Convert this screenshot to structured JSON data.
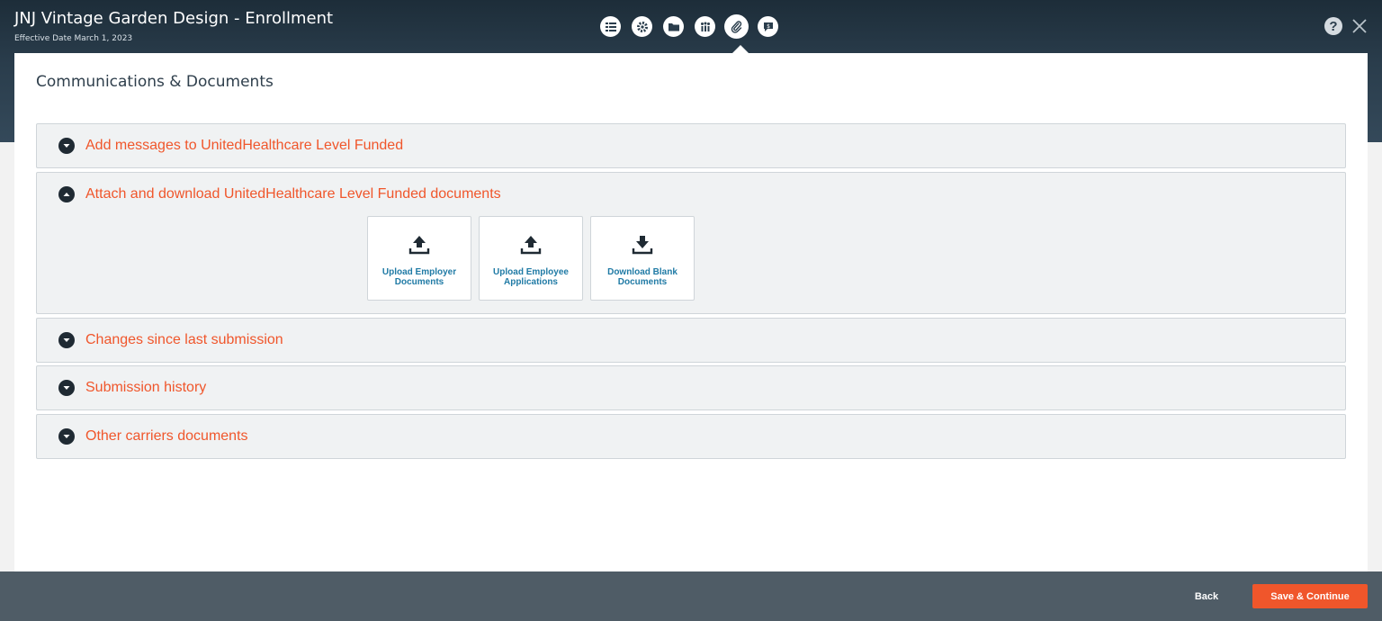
{
  "header": {
    "title": "JNJ Vintage Garden Design - Enrollment",
    "subtitle": "Effective Date March 1, 2023",
    "nav_icons": [
      "checklist-icon",
      "gear-icon",
      "folder-icon",
      "people-icon",
      "paperclip-icon",
      "message-dollar-icon"
    ],
    "active_nav": "paperclip-icon",
    "help_label": "?"
  },
  "page": {
    "title": "Communications & Documents"
  },
  "sections": [
    {
      "label": "Add messages to UnitedHealthcare Level Funded",
      "expanded": false
    },
    {
      "label": "Attach and download UnitedHealthcare Level Funded documents",
      "expanded": true
    },
    {
      "label": "Changes since last submission",
      "expanded": false
    },
    {
      "label": "Submission history",
      "expanded": false
    },
    {
      "label": "Other carriers documents",
      "expanded": false
    }
  ],
  "tiles": [
    {
      "line1": "Upload Employer",
      "line2": "Documents",
      "icon": "upload-icon"
    },
    {
      "line1": "Upload Employee",
      "line2": "Applications",
      "icon": "upload-icon"
    },
    {
      "line1": "Download Blank",
      "line2": "Documents",
      "icon": "download-icon"
    }
  ],
  "footer": {
    "back_label": "Back",
    "save_label": "Save & Continue"
  },
  "colors": {
    "accent": "#f0562b",
    "header_bg": "#2a3d4c",
    "footer_bg": "#4f5c66",
    "tile_text": "#1f7aa5"
  }
}
